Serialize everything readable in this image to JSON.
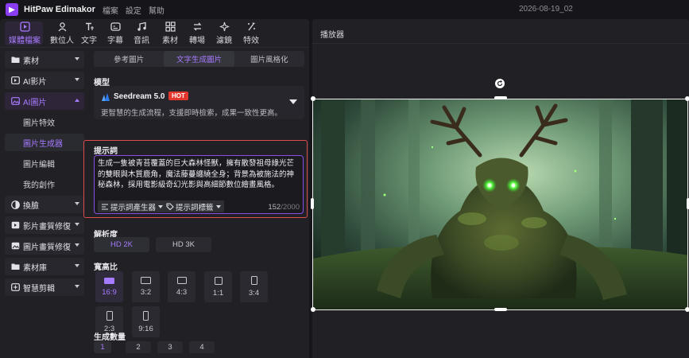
{
  "app": {
    "title": "HitPaw Edimakor",
    "menu": [
      "檔案",
      "設定",
      "幫助"
    ],
    "project_name": "2026-08-19_02",
    "logo_glyph": "▶"
  },
  "toolbar": {
    "items": [
      {
        "label": "媒體檔案",
        "icon": "media-icon",
        "active": true
      },
      {
        "label": "數位人",
        "icon": "avatar-icon"
      },
      {
        "label": "文字",
        "icon": "text-icon"
      },
      {
        "label": "字幕",
        "icon": "subtitle-icon"
      },
      {
        "label": "音訊",
        "icon": "audio-icon"
      },
      {
        "label": "素材",
        "icon": "material-icon"
      },
      {
        "label": "轉場",
        "icon": "transition-icon"
      },
      {
        "label": "濾鏡",
        "icon": "filter-icon"
      },
      {
        "label": "特效",
        "icon": "effects-icon"
      }
    ]
  },
  "sidebar": {
    "items": [
      {
        "label": "素材",
        "icon": "folder-icon"
      },
      {
        "label": "AI影片",
        "icon": "ai-video-icon"
      },
      {
        "label": "AI圖片",
        "icon": "ai-image-icon",
        "active": true,
        "expanded": true
      }
    ],
    "sub_items": [
      {
        "label": "圖片特效"
      },
      {
        "label": "圖片生成器",
        "active": true
      },
      {
        "label": "圖片編輯"
      },
      {
        "label": "我的創作"
      }
    ],
    "items_after": [
      {
        "label": "換臉",
        "icon": "face-swap-icon"
      },
      {
        "label": "影片畫質修復",
        "icon": "video-enhance-icon"
      },
      {
        "label": "圖片畫質修復",
        "icon": "image-enhance-icon"
      },
      {
        "label": "素材庫",
        "icon": "library-icon"
      },
      {
        "label": "智慧剪輯",
        "icon": "smart-edit-icon"
      }
    ]
  },
  "generator": {
    "tabs": [
      "參考圖片",
      "文字生成圖片",
      "圖片風格化"
    ],
    "active_tab": 1,
    "model_label": "模型",
    "model_name": "Seedream 5.0",
    "model_badge": "HOT",
    "model_desc": "更智慧的生成流程，支援即時檢索，成果一致性更高。",
    "prompt_label": "提示詞",
    "prompt_text": "生成一隻被青苔覆蓋的巨大森林怪獸，擁有散發祖母綠光芒的雙眼與木質鹿角，魔法藤蔓纏繞全身；背景為被施法的神秘森林，採用電影級奇幻光影與高細節數位繪畫風格。",
    "prompt_generator_btn": "提示詞產生器",
    "prompt_tags_btn": "提示詞標籤",
    "prompt_count": "152",
    "prompt_max": "/2000",
    "resolution_label": "解析度",
    "resolutions": [
      "HD 2K",
      "HD 3K"
    ],
    "active_resolution": 0,
    "aspect_label": "寬高比",
    "aspects": [
      "16:9",
      "3:2",
      "4:3",
      "1:1",
      "3:4",
      "2:3",
      "9:16"
    ],
    "active_aspect": 0,
    "count_label": "生成數量",
    "counts": [
      "1",
      "2",
      "3",
      "4"
    ],
    "active_count": 0
  },
  "player": {
    "title": "播放器"
  },
  "colors": {
    "accent": "#a77bff",
    "hot": "#e3362d",
    "highlight_frame": "#e04b4b"
  }
}
